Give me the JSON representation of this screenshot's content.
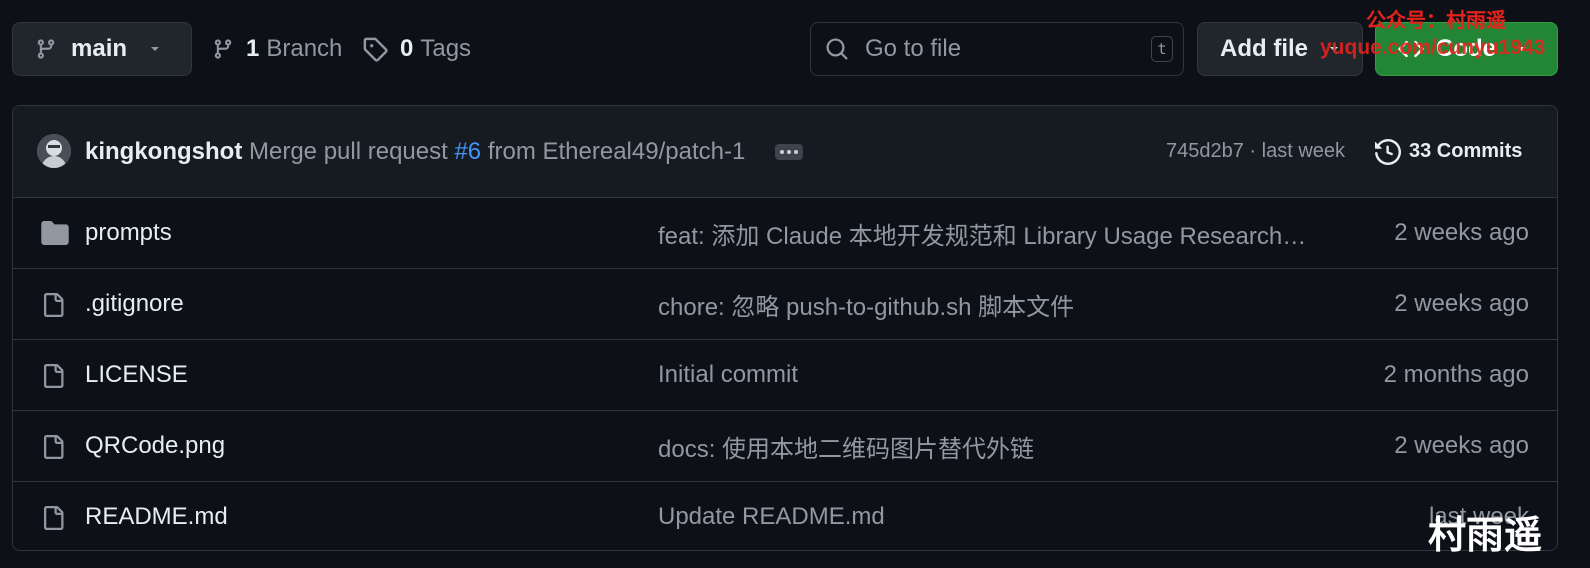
{
  "toolbar": {
    "branch_name": "main",
    "branch_count": "1",
    "branch_label": "Branch",
    "tag_count": "0",
    "tag_label": "Tags",
    "search_placeholder": "Go to file",
    "search_shortcut": "t",
    "add_file_label": "Add file",
    "code_label": "Code"
  },
  "latest_commit": {
    "author": "kingkongshot",
    "message_prefix": "Merge pull request ",
    "pr_ref": "#6",
    "message_suffix": " from Ethereal49/patch-1",
    "sha_and_time": "745d2b7 · last week",
    "commits_count_label": "33 Commits"
  },
  "files": [
    {
      "type": "folder",
      "name": "prompts",
      "message": "feat: 添加 Claude 本地开发规范和 Library Usage Researcher ...",
      "date": "2 weeks ago"
    },
    {
      "type": "file",
      "name": ".gitignore",
      "message": "chore: 忽略 push-to-github.sh 脚本文件",
      "date": "2 weeks ago"
    },
    {
      "type": "file",
      "name": "LICENSE",
      "message": "Initial commit",
      "date": "2 months ago"
    },
    {
      "type": "file",
      "name": "QRCode.png",
      "message": "docs: 使用本地二维码图片替代外链",
      "date": "2 weeks ago"
    },
    {
      "type": "file",
      "name": "README.md",
      "message": "Update README.md",
      "date": "last week"
    }
  ],
  "watermark": {
    "top": "公众号：村雨遥",
    "url": "yuque.com/cunyu1943",
    "corner": "村雨遥"
  },
  "colors": {
    "background": "#0d1117",
    "code_button": "#238636",
    "link": "#4493f8",
    "watermark_red": "#e5231b"
  }
}
